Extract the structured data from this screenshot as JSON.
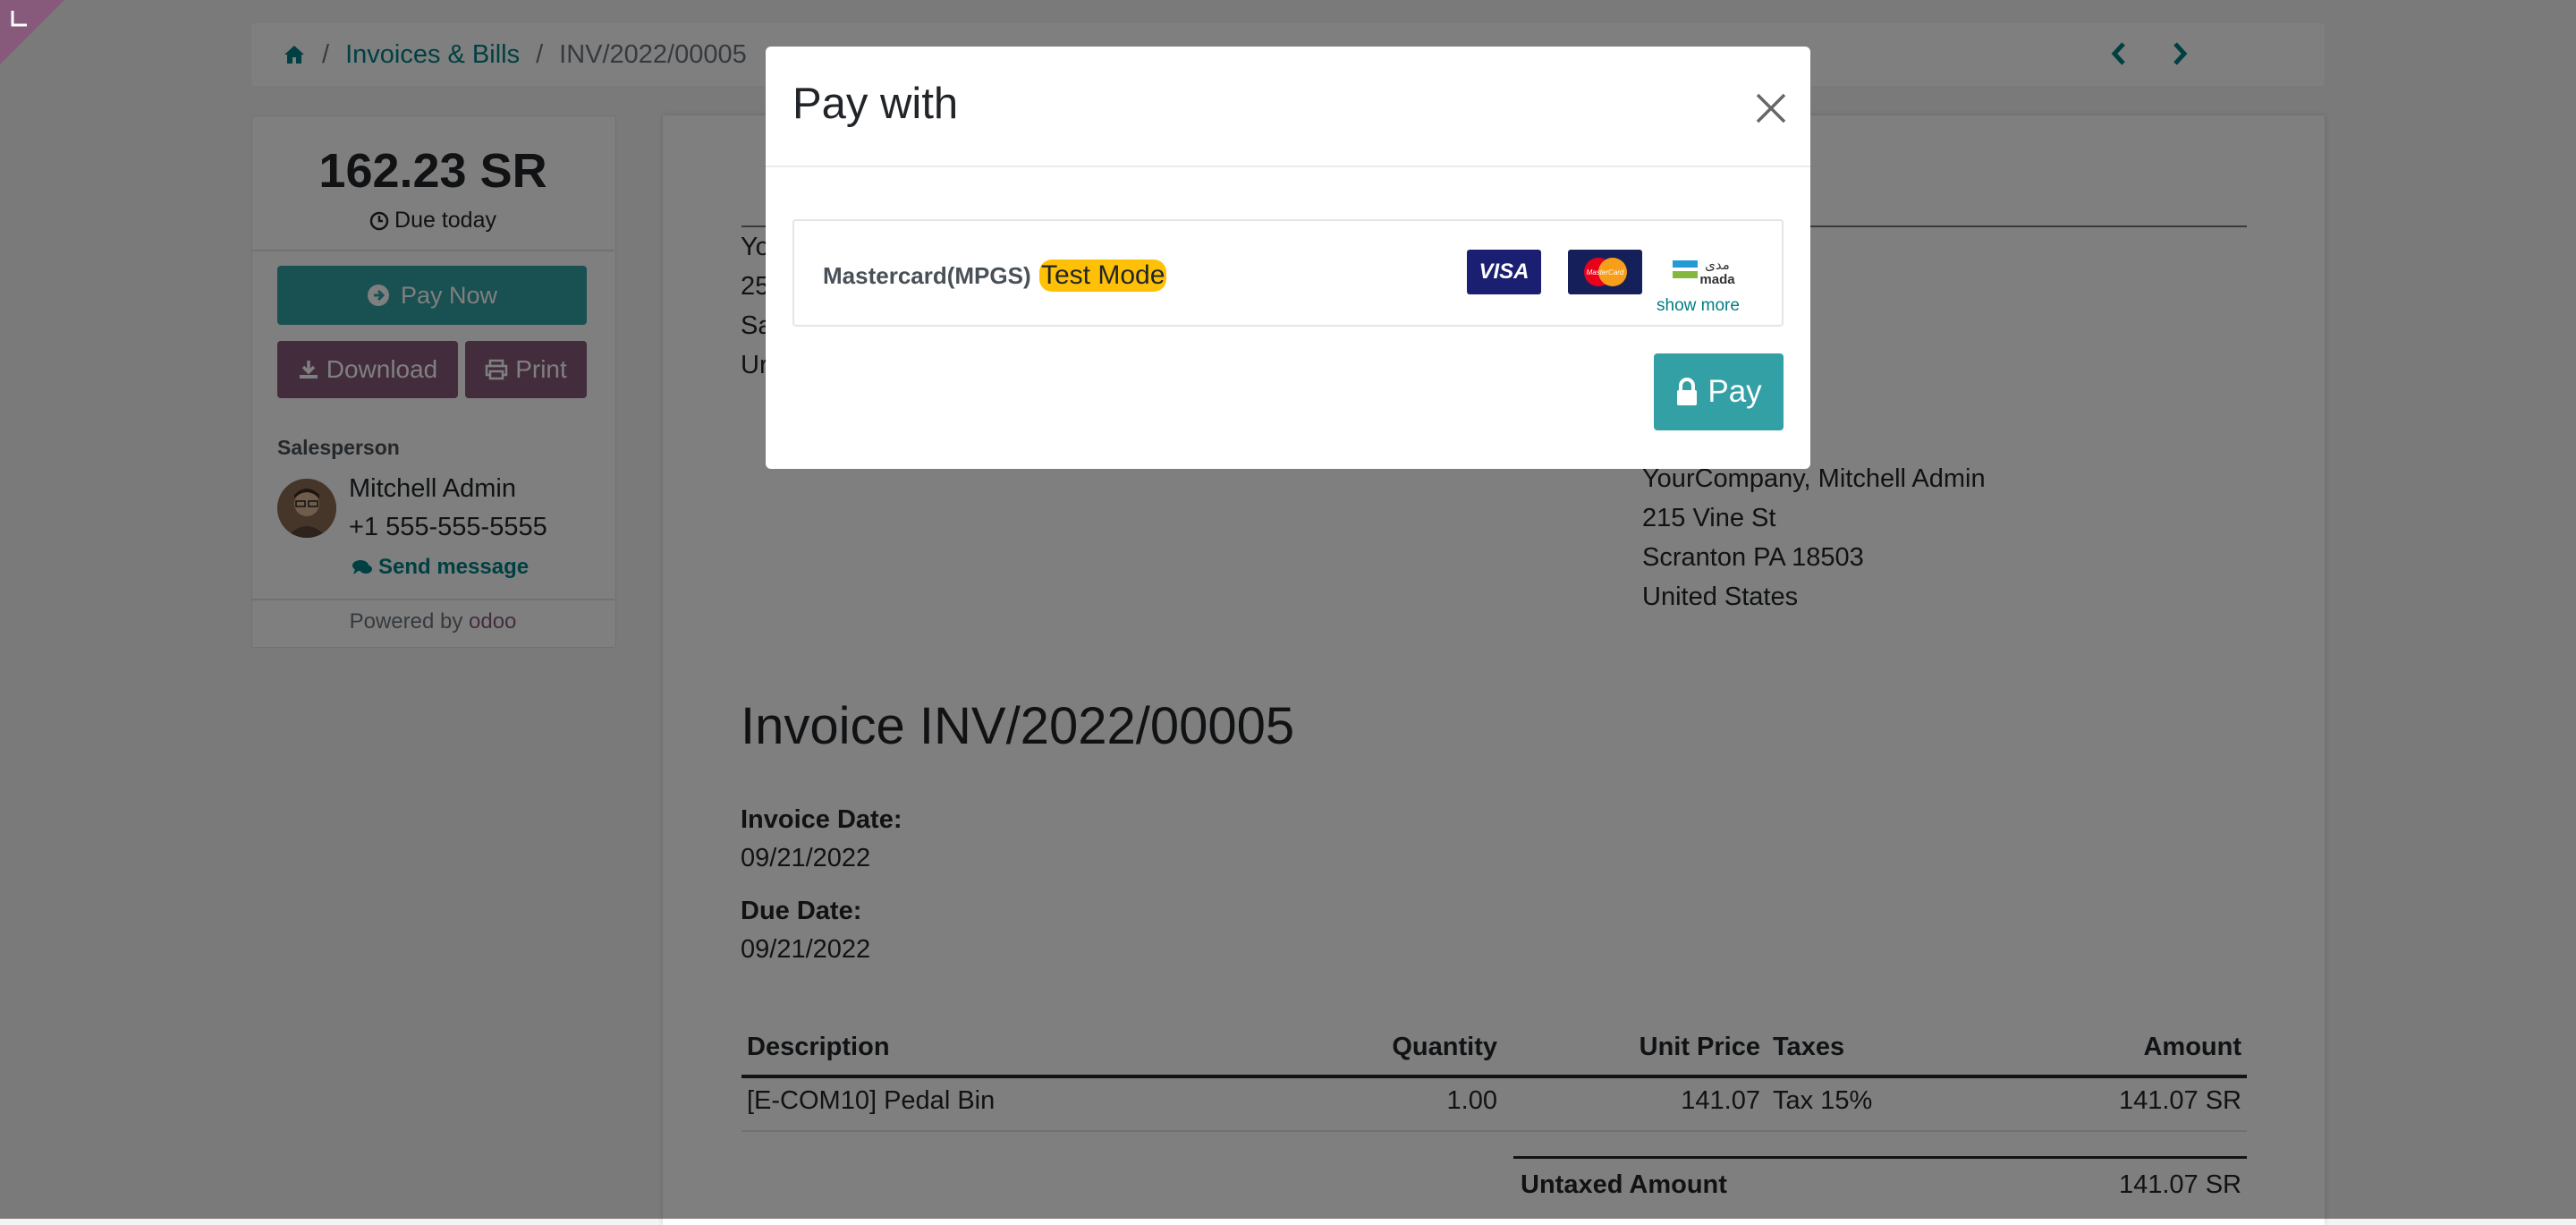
{
  "breadcrumb": {
    "home_icon": "home-icon",
    "section": "Invoices & Bills",
    "current": "INV/2022/00005",
    "separator": "/"
  },
  "pager": {
    "prev_icon": "chevron-left-icon",
    "next_icon": "chevron-right-icon"
  },
  "sidebar": {
    "amount": "162.23 SR",
    "due": "Due today",
    "pay_now": "Pay Now",
    "download": "Download",
    "print": "Print",
    "salesperson_label": "Salesperson",
    "salesperson_name": "Mitchell Admin",
    "salesperson_phone": "+1 555-555-5555",
    "send_message": "Send message",
    "powered_by": "Powered by",
    "brand": "odoo"
  },
  "document": {
    "addr_left_lines": [
      "Yo",
      "25",
      "Sa",
      "Ur"
    ],
    "addr_right_lines": [
      "YourCompany, Mitchell Admin",
      "215 Vine St",
      "Scranton PA 18503",
      "United States"
    ],
    "title": "Invoice INV/2022/00005",
    "invoice_date_label": "Invoice Date:",
    "invoice_date": "09/21/2022",
    "due_date_label": "Due Date:",
    "due_date": "09/21/2022",
    "columns": [
      "Description",
      "Quantity",
      "Unit Price",
      "Taxes",
      "Amount"
    ],
    "rows": [
      {
        "description": "[E-COM10] Pedal Bin",
        "quantity": "1.00",
        "unit_price": "141.07",
        "taxes": "Tax 15%",
        "amount": "141.07 SR"
      }
    ],
    "untaxed_label": "Untaxed Amount",
    "untaxed_value": "141.07 SR"
  },
  "modal": {
    "title": "Pay with",
    "provider_name": "Mastercard(MPGS)",
    "test_badge": "Test Mode",
    "card_visa": "VISA",
    "card_mastercard": "MasterCard",
    "card_mada_ar": "مدى",
    "card_mada": "mada",
    "show_more": "show more",
    "pay_button": "Pay"
  },
  "colors": {
    "teal": "#32a0a5",
    "purple": "#875a7b",
    "link": "#017e84",
    "badge": "#ffc107"
  }
}
